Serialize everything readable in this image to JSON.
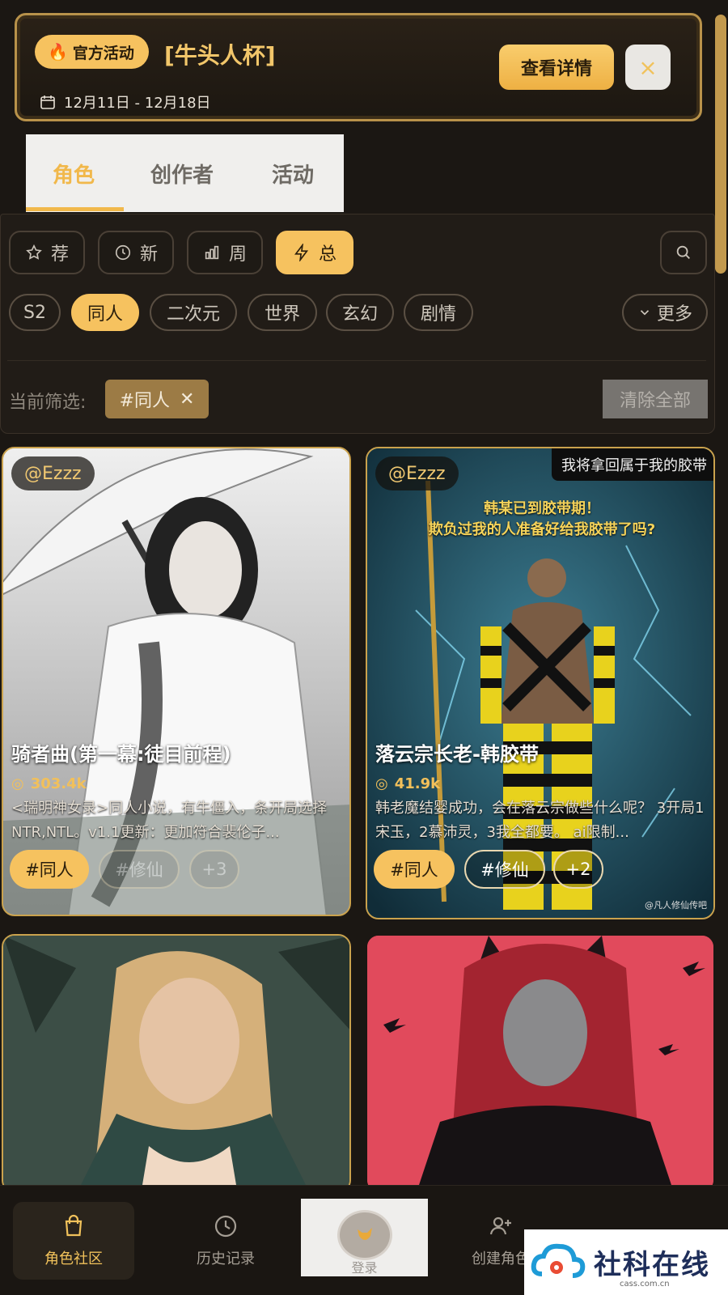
{
  "banner": {
    "pill": "官方活动",
    "title": "[牛头人杯]",
    "date": "12月11日 - 12月18日",
    "detail": "查看详情",
    "close": "×"
  },
  "tabs": [
    "角色",
    "创作者",
    "活动"
  ],
  "sort": [
    "荐",
    "新",
    "周",
    "总"
  ],
  "chips": [
    "S2",
    "同人",
    "二次元",
    "世界",
    "玄幻",
    "剧情"
  ],
  "more": "更多",
  "current": {
    "label": "当前筛选:",
    "tag": "#同人",
    "clear": "清除全部"
  },
  "cards": [
    {
      "author": "@Ezzz",
      "title": "骑者曲(第一幕:徒目前程)",
      "stats": "303.4k",
      "desc": "<瑞明神女录>同人小说，有牛僵入，条开局选择NTR,NTL。v1.1更新：更加符合裴伦子...",
      "tags": [
        "#同人",
        "#修仙",
        "+3"
      ]
    },
    {
      "author": "@Ezzz",
      "overlay": "我将拿回属于我的胶带",
      "poster_line1": "韩某已到胶带期！",
      "poster_line2": "欺负过我的人准备好给我胶带了吗?",
      "title": "落云宗长老-韩胶带",
      "stats": "41.9k",
      "desc": "韩老魔结婴成功，会在落云宗做些什么呢？ 3开局1宋玉，2慕沛灵，3我全都要。 ai限制...",
      "tags": [
        "#同人",
        "#修仙",
        "+2"
      ],
      "credit": "@凡人修仙传吧"
    }
  ],
  "nav": [
    "角色社区",
    "历史记录",
    "登录",
    "创建角色"
  ],
  "watermark": {
    "text": "社科在线",
    "sub": "cass.com.cn"
  },
  "colors": {
    "accent": "#f6c25f",
    "bg": "#1b1713"
  }
}
